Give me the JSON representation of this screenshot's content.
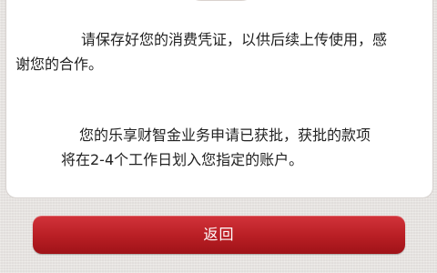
{
  "notice": {
    "paragraphs": [
      {
        "lines": [
          "请保存好您的消费凭证，以供后续上传使用，感",
          "谢您的合作。"
        ]
      },
      {
        "lines": [
          "您的乐享财智金业务申请已获批，获批的款项",
          "将在2-4个工作日划入您指定的账户。"
        ]
      }
    ]
  },
  "actions": {
    "return_label": "返回"
  }
}
